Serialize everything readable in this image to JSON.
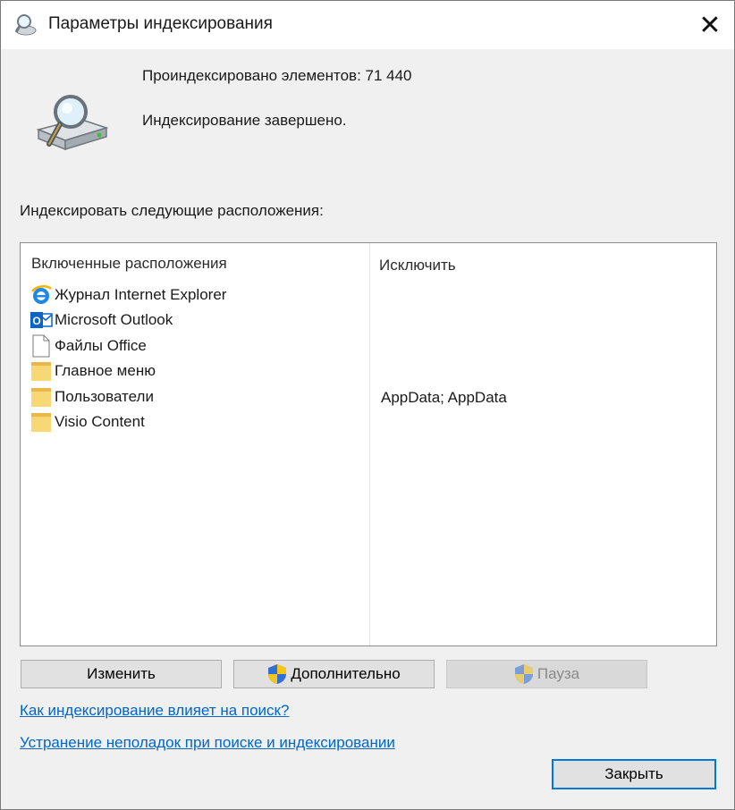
{
  "window": {
    "title": "Параметры индексирования",
    "close_glyph": "✕"
  },
  "status": {
    "items_indexed": "Проиндексировано элементов: 71 440",
    "state": "Индексирование завершено."
  },
  "locations_label": "Индексировать следующие расположения:",
  "table": {
    "included_header": "Включенные расположения",
    "excluded_header": "Исключить",
    "rows": [
      {
        "label": "Журнал Internet Explorer",
        "icon": "ie-icon",
        "exclude": ""
      },
      {
        "label": "Microsoft Outlook",
        "icon": "outlook-icon",
        "exclude": ""
      },
      {
        "label": "Файлы Office",
        "icon": "document-icon",
        "exclude": ""
      },
      {
        "label": "Главное меню",
        "icon": "folder-icon",
        "exclude": ""
      },
      {
        "label": "Пользователи",
        "icon": "folder-icon",
        "exclude": "AppData; AppData"
      },
      {
        "label": "Visio Content",
        "icon": "folder-icon",
        "exclude": ""
      }
    ]
  },
  "buttons": {
    "modify": "Изменить",
    "advanced": "Дополнительно",
    "pause": "Пауза",
    "close": "Закрыть"
  },
  "links": {
    "how_affects": "Как индексирование влияет на поиск?",
    "troubleshoot": "Устранение неполадок при поиске и индексировании"
  },
  "colors": {
    "link": "#0066cc",
    "focus_border": "#0078d7",
    "folder": "#f8d775"
  }
}
